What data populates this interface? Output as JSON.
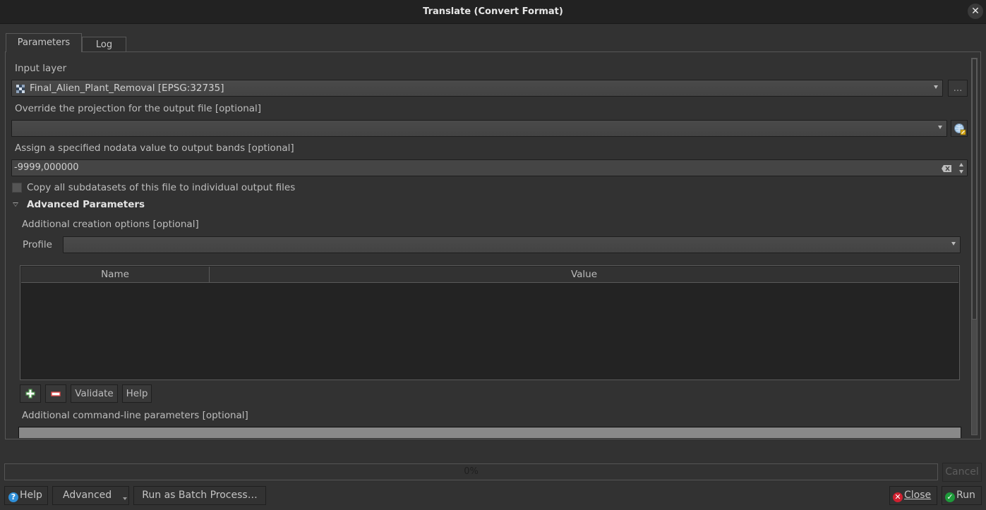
{
  "window": {
    "title": "Translate (Convert Format)",
    "close_icon": "close-icon"
  },
  "tabs": [
    {
      "label": "Parameters",
      "active": true
    },
    {
      "label": "Log",
      "active": false
    }
  ],
  "params": {
    "input_layer": {
      "label": "Input layer",
      "value": "Final_Alien_Plant_Removal [EPSG:32735]",
      "icon": "raster-layer-icon",
      "browse_label": "..."
    },
    "projection": {
      "label": "Override the projection for the output file [optional]",
      "value": "",
      "icon": "projection-selector-icon"
    },
    "nodata": {
      "label": "Assign a specified nodata value to output bands [optional]",
      "value": "-9999,000000"
    },
    "copy_subdatasets": {
      "label": "Copy all subdatasets of this file to individual output files",
      "checked": false
    },
    "advanced": {
      "label": "Advanced Parameters",
      "expanded": true,
      "creation_options_label": "Additional creation options [optional]",
      "profile_label": "Profile",
      "profile_value": "",
      "table_columns": [
        "Name",
        "Value"
      ],
      "table_rows": [],
      "add_icon": "plus-icon",
      "remove_icon": "minus-icon",
      "validate_label": "Validate",
      "help_label": "Help",
      "cmdline_label": "Additional command-line parameters [optional]",
      "cmdline_value": ""
    }
  },
  "progress": {
    "percent": 0,
    "text": "0%",
    "cancel_label": "Cancel"
  },
  "footer": {
    "help_label": "Help",
    "advanced_label": "Advanced",
    "batch_label": "Run as Batch Process…",
    "close_label": "Close",
    "run_label": "Run"
  },
  "colors": {
    "help_icon": "#2f8fd8",
    "close_icon": "#d0202f",
    "run_icon": "#1e9a3a",
    "add_icon": "#4f9a4f",
    "remove_icon": "#e04848"
  }
}
